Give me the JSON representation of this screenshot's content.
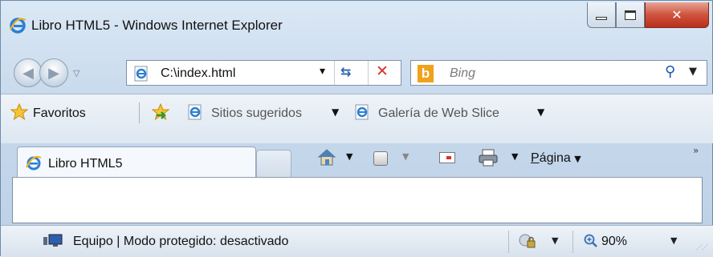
{
  "window": {
    "title": "Libro HTML5 - Windows Internet Explorer"
  },
  "icons": {
    "browser": "ie-icon",
    "favorites": "star-icon",
    "add_favorite": "add-to-favorites-icon",
    "home": "home-icon",
    "feeds": "feeds-icon",
    "mail": "read-mail-icon",
    "print": "printer-icon",
    "network": "computer-network-icon",
    "protected_mode": "globe-lock-icon",
    "zoom": "magnifier-icon",
    "search": "search-icon",
    "refresh": "refresh-icon",
    "stop": "stop-icon"
  },
  "colors": {
    "close_button": "#d0533d",
    "stop": "#d4342a",
    "bing": "#f0a21a",
    "ie_blue": "#2a62b4"
  },
  "address": {
    "url": "C:\\index.html"
  },
  "search": {
    "provider_letter": "b",
    "placeholder": "Bing"
  },
  "favorites_bar": {
    "favorites_label": "Favoritos",
    "suggested_sites_label": "Sitios sugeridos",
    "web_slice_label": "Galería de Web Slice"
  },
  "tabs": [
    {
      "label": "Libro HTML5",
      "active": true
    }
  ],
  "command_bar": {
    "page_label_underlined": "P",
    "page_label_rest": "ágina",
    "more_glyph": "»"
  },
  "status_bar": {
    "text": "Equipo | Modo protegido: desactivado",
    "zoom": "90%"
  }
}
